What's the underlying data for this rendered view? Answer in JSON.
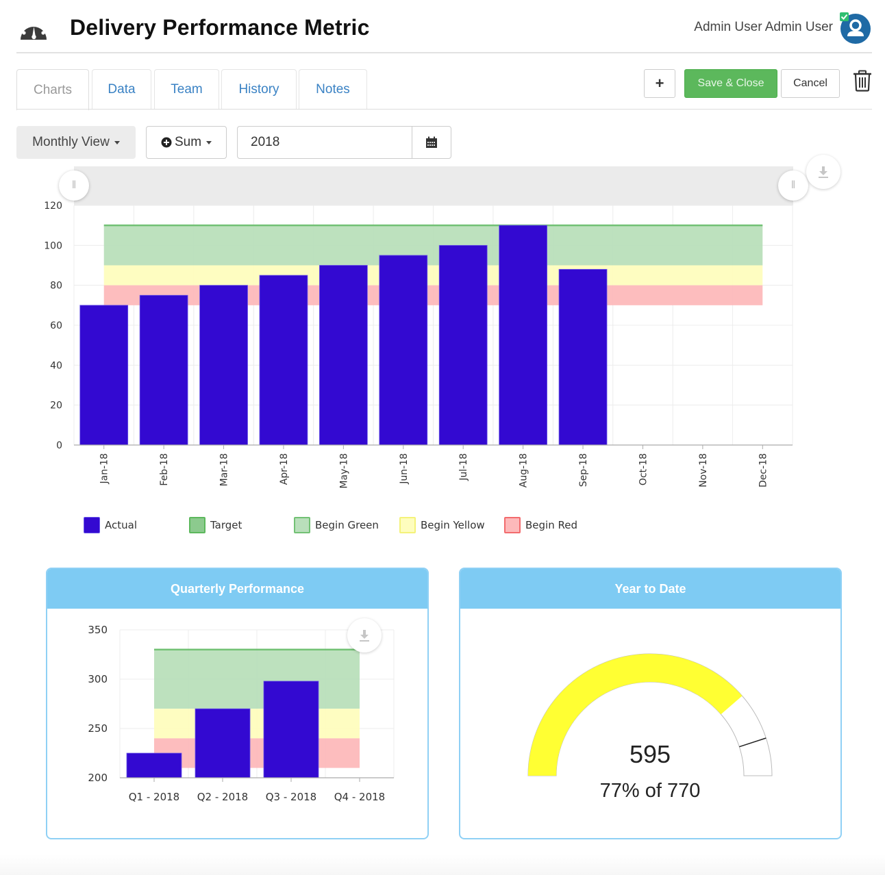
{
  "header": {
    "icon": "dashboard-gauge-icon",
    "title": "Delivery Performance Metric",
    "user_name": "Admin User Admin User",
    "avatar_icon": "user-avatar-icon",
    "avatar_badge_icon": "check-badge-icon"
  },
  "tabs": [
    {
      "label": "Charts",
      "active": true
    },
    {
      "label": "Data",
      "active": false
    },
    {
      "label": "Team",
      "active": false
    },
    {
      "label": "History",
      "active": false
    },
    {
      "label": "Notes",
      "active": false
    }
  ],
  "toolbar": {
    "add_label": "+",
    "save_label": "Save & Close",
    "cancel_label": "Cancel",
    "delete_icon": "trash-icon"
  },
  "filters": {
    "view_label": "Monthly View",
    "aggregate_label": "Sum",
    "year_value": "2018",
    "calendar_icon": "calendar-icon"
  },
  "colors": {
    "actual": "#3309d1",
    "target": "#5cb85c",
    "begin_green": "#b9dfbb",
    "begin_yellow": "#fefdbe",
    "begin_red": "#fdb9ba",
    "panel_header": "#7ecbf3",
    "gauge_fill": "#ffff33",
    "save_button": "#5cb85c"
  },
  "chart_data": [
    {
      "type": "bar",
      "title": "",
      "xlabel": "",
      "ylabel": "",
      "categories": [
        "Jan-18",
        "Feb-18",
        "Mar-18",
        "Apr-18",
        "May-18",
        "Jun-18",
        "Jul-18",
        "Aug-18",
        "Sep-18",
        "Oct-18",
        "Nov-18",
        "Dec-18"
      ],
      "series": [
        {
          "name": "Actual",
          "values": [
            70,
            75,
            80,
            85,
            90,
            95,
            100,
            110,
            88,
            null,
            null,
            null
          ]
        }
      ],
      "bands": [
        {
          "name": "Begin Green",
          "from": 90,
          "to": 110
        },
        {
          "name": "Begin Yellow",
          "from": 80,
          "to": 90
        },
        {
          "name": "Begin Red",
          "from": 70,
          "to": 80
        }
      ],
      "target": {
        "name": "Target",
        "value": 110
      },
      "yticks": [
        0,
        20,
        40,
        60,
        80,
        100,
        120
      ],
      "ylim": [
        0,
        120
      ],
      "grid": true,
      "legend": [
        {
          "label": "Actual",
          "key": "actual"
        },
        {
          "label": "Target",
          "key": "target"
        },
        {
          "label": "Begin Green",
          "key": "begin_green"
        },
        {
          "label": "Begin Yellow",
          "key": "begin_yellow"
        },
        {
          "label": "Begin Red",
          "key": "begin_red"
        }
      ],
      "legend_position": "bottom-left"
    },
    {
      "type": "bar",
      "title": "Quarterly Performance",
      "xlabel": "",
      "ylabel": "",
      "categories": [
        "Q1 - 2018",
        "Q2 - 2018",
        "Q3 - 2018",
        "Q4 - 2018"
      ],
      "series": [
        {
          "name": "Actual",
          "values": [
            225,
            270,
            298,
            null
          ]
        }
      ],
      "bands": [
        {
          "name": "Begin Green",
          "from": 270,
          "to": 330
        },
        {
          "name": "Begin Yellow",
          "from": 240,
          "to": 270
        },
        {
          "name": "Begin Red",
          "from": 210,
          "to": 240
        }
      ],
      "target": {
        "name": "Target",
        "value": 330
      },
      "yticks": [
        200,
        250,
        300,
        350
      ],
      "ylim": [
        200,
        350
      ],
      "grid": true
    },
    {
      "type": "gauge",
      "title": "Year to Date",
      "value": 595,
      "max": 770,
      "percent_label": "77% of 770",
      "value_label": "595",
      "marker_fraction": 0.9
    }
  ],
  "panels": {
    "quarterly_title": "Quarterly Performance",
    "ytd_title": "Year to Date"
  },
  "icons": {
    "download": "download-icon",
    "navigator_handle": "drag-handle-icon"
  }
}
